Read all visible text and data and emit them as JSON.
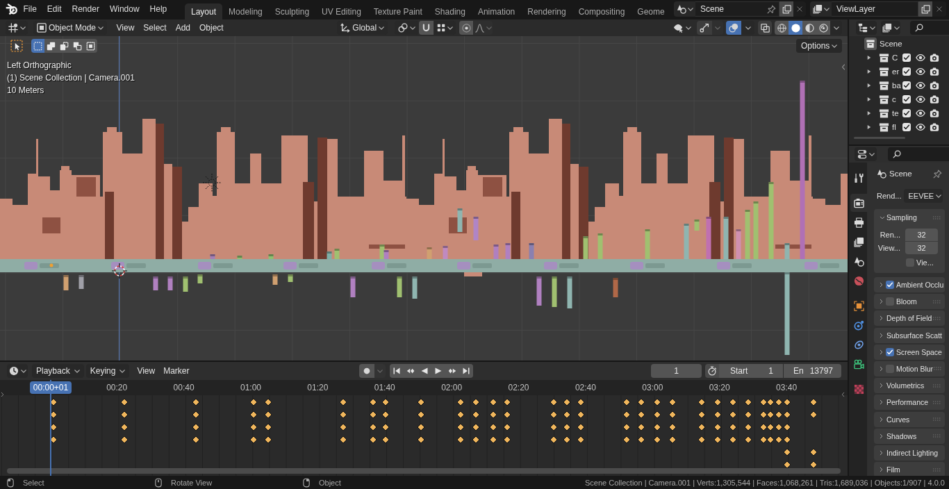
{
  "topbar": {
    "menus": [
      "File",
      "Edit",
      "Render",
      "Window",
      "Help"
    ],
    "workspaces": [
      {
        "label": "Layout",
        "selected": true
      },
      {
        "label": "Modeling",
        "selected": false
      },
      {
        "label": "Sculpting",
        "selected": false
      },
      {
        "label": "UV Editing",
        "selected": false
      },
      {
        "label": "Texture Paint",
        "selected": false
      },
      {
        "label": "Shading",
        "selected": false
      },
      {
        "label": "Animation",
        "selected": false
      },
      {
        "label": "Rendering",
        "selected": false
      },
      {
        "label": "Compositing",
        "selected": false
      },
      {
        "label": "Geome",
        "selected": false
      }
    ],
    "scene": "Scene",
    "view_layer": "ViewLayer"
  },
  "viewport": {
    "mode": "Object Mode",
    "menus": [
      "View",
      "Select",
      "Add",
      "Object"
    ],
    "orientation": "Global",
    "snap": false,
    "proportional_editing": false,
    "overlays": true,
    "xray": false,
    "shading": [
      {
        "kind": "wireframe",
        "selected": false
      },
      {
        "kind": "solid",
        "selected": true
      },
      {
        "kind": "material",
        "selected": false
      },
      {
        "kind": "rendered",
        "selected": false
      }
    ],
    "select_modes": [
      {
        "kind": "set",
        "selected": true
      },
      {
        "kind": "extend",
        "selected": false
      },
      {
        "kind": "subtract",
        "selected": false
      },
      {
        "kind": "invert",
        "selected": false
      },
      {
        "kind": "intersect",
        "selected": false
      }
    ],
    "options": "Options",
    "info": [
      "Left Orthographic",
      "(1) Scene Collection | Camera.001",
      "10 Meters"
    ]
  },
  "outliner": {
    "root": "Scene",
    "collections": [
      {
        "name": "C",
        "expanded": false,
        "checked": true
      },
      {
        "name": "er",
        "expanded": false,
        "checked": true
      },
      {
        "name": "ba",
        "expanded": false,
        "checked": true
      },
      {
        "name": "c",
        "expanded": false,
        "checked": true
      },
      {
        "name": "te",
        "expanded": false,
        "checked": true
      },
      {
        "name": "fl",
        "expanded": false,
        "checked": true
      }
    ]
  },
  "properties": {
    "tabs": [
      {
        "kind": "tool",
        "selected": false
      },
      {
        "kind": "render",
        "selected": true
      },
      {
        "kind": "output",
        "selected": false
      },
      {
        "kind": "view_layer",
        "selected": false
      },
      {
        "kind": "scene",
        "selected": false
      },
      {
        "kind": "world",
        "selected": false
      },
      {
        "kind": "object",
        "selected": false
      },
      {
        "kind": "physics",
        "selected": false
      },
      {
        "kind": "constraints",
        "selected": false
      },
      {
        "kind": "data",
        "selected": false
      },
      {
        "kind": "texture",
        "selected": false
      }
    ],
    "context": "Scene",
    "render_engine": {
      "label": "Rend...",
      "value": "EEVEE"
    },
    "panels": [
      {
        "title": "Sampling",
        "kind": "plain",
        "expanded": true,
        "fields": [
          {
            "label": "Ren...",
            "value": "32"
          },
          {
            "label": "View...",
            "value": "32"
          }
        ],
        "options": [
          {
            "label": "Vie...",
            "checked": false
          }
        ]
      },
      {
        "title": "Ambient Occlu",
        "kind": "toggle",
        "checked": true,
        "expanded": false
      },
      {
        "title": "Bloom",
        "kind": "toggle",
        "checked": false,
        "expanded": false
      },
      {
        "title": "Depth of Field",
        "kind": "plain",
        "expanded": false
      },
      {
        "title": "Subsurface Scatt",
        "kind": "plain",
        "expanded": false
      },
      {
        "title": "Screen Space",
        "kind": "toggle",
        "checked": true,
        "expanded": false
      },
      {
        "title": "Motion Blur",
        "kind": "toggle",
        "checked": false,
        "expanded": false
      },
      {
        "title": "Volumetrics",
        "kind": "plain",
        "expanded": false
      },
      {
        "title": "Performance",
        "kind": "plain",
        "expanded": false
      },
      {
        "title": "Curves",
        "kind": "plain",
        "expanded": false
      },
      {
        "title": "Shadows",
        "kind": "plain",
        "expanded": false
      },
      {
        "title": "Indirect Lighting",
        "kind": "plain",
        "expanded": false
      },
      {
        "title": "Film",
        "kind": "plain",
        "expanded": false
      }
    ]
  },
  "timeline": {
    "menus": [
      {
        "label": "Playback",
        "kind": "dropdown"
      },
      {
        "label": "Keying",
        "kind": "dropdown"
      },
      {
        "label": "View",
        "kind": "menu"
      },
      {
        "label": "Marker",
        "kind": "menu"
      }
    ],
    "auto_keying": false,
    "current_frame": "1",
    "preview_range": false,
    "start": {
      "label": "Start",
      "value": "1"
    },
    "end": {
      "label": "En",
      "value": "13797"
    },
    "playhead": "00:00+01",
    "ticks": [
      "00:20",
      "00:40",
      "01:00",
      "01:20",
      "01:40",
      "02:00",
      "02:20",
      "02:40",
      "03:00",
      "03:20",
      "03:40"
    ]
  },
  "status_bar": {
    "hints": [
      {
        "kind": "left",
        "label": "Select"
      },
      {
        "kind": "middle",
        "label": "Rotate View"
      },
      {
        "kind": "right",
        "label": "Object"
      }
    ],
    "stats": "Scene Collection | Camera.001 | Verts:1,305,544 | Faces:1,068,261 | Tris:1,689,036 | Objects:1/907 | 4.0.0"
  }
}
